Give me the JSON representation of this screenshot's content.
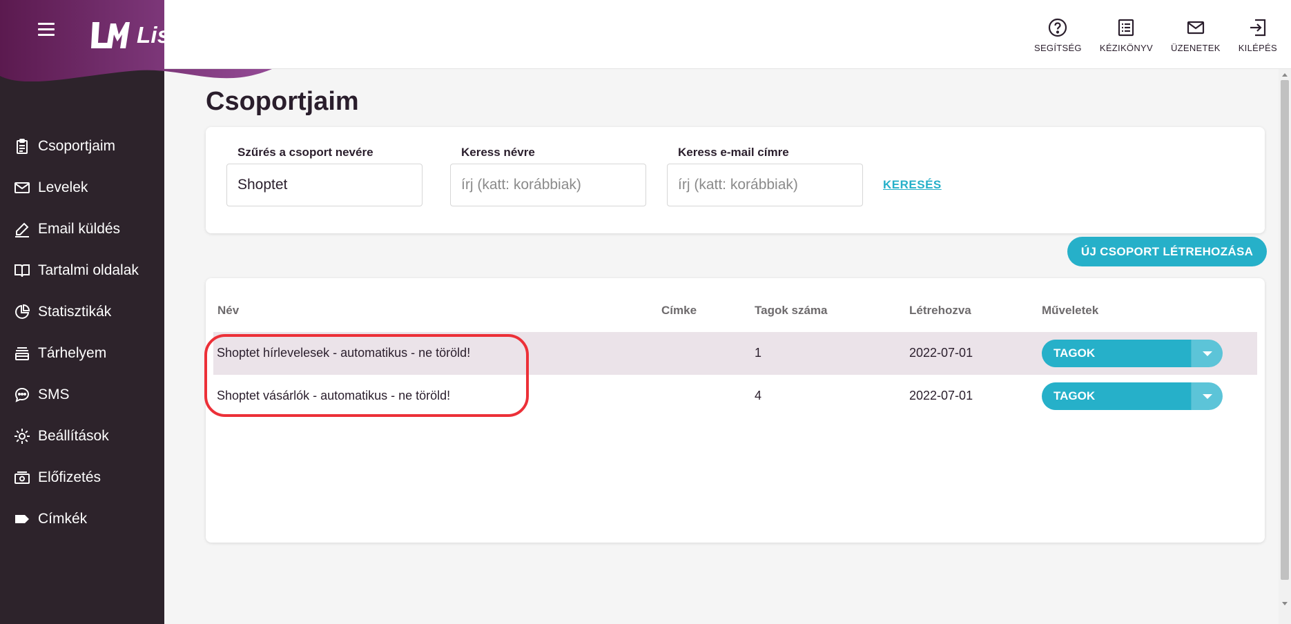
{
  "brand": {
    "name": "ListaMester",
    "gradient_start": "#5b1a4f",
    "gradient_end": "#a257a8"
  },
  "sidebar": {
    "items": [
      {
        "label": "Csoportjaim",
        "icon": "clipboard-icon"
      },
      {
        "label": "Levelek",
        "icon": "envelope-icon"
      },
      {
        "label": "Email küldés",
        "icon": "pencil-icon"
      },
      {
        "label": "Tartalmi oldalak",
        "icon": "book-icon"
      },
      {
        "label": "Statisztikák",
        "icon": "pie-chart-icon"
      },
      {
        "label": "Tárhelyem",
        "icon": "storage-icon"
      },
      {
        "label": "SMS",
        "icon": "chat-icon"
      },
      {
        "label": "Beállítások",
        "icon": "gear-icon"
      },
      {
        "label": "Előfizetés",
        "icon": "money-icon"
      },
      {
        "label": "Címkék",
        "icon": "tag-icon"
      }
    ]
  },
  "header": {
    "actions": [
      {
        "label": "SEGÍTSÉG",
        "icon": "help-icon"
      },
      {
        "label": "KÉZIKÖNYV",
        "icon": "manual-icon"
      },
      {
        "label": "ÜZENETEK",
        "icon": "mail-icon"
      },
      {
        "label": "KILÉPÉS",
        "icon": "logout-icon"
      }
    ]
  },
  "page": {
    "title": "Csoportjaim"
  },
  "filters": {
    "group_label": "Szűrés a csoport nevére",
    "group_value": "Shoptet",
    "name_label": "Keress névre",
    "name_placeholder": "írj (katt: korábbiak)",
    "email_label": "Keress e-mail címre",
    "email_placeholder": "írj (katt: korábbiak)",
    "search_label": "KERESÉS"
  },
  "new_group_button": "ÚJ CSOPORT LÉTREHOZÁSA",
  "table": {
    "columns": [
      "Név",
      "Címke",
      "Tagok száma",
      "Létrehozva",
      "Műveletek"
    ],
    "rows": [
      {
        "name": "Shoptet hírlevelesek - automatikus - ne töröld!",
        "label": "",
        "members": "1",
        "created": "2022-07-01",
        "action": "TAGOK"
      },
      {
        "name": "Shoptet vásárlók - automatikus - ne töröld!",
        "label": "",
        "members": "4",
        "created": "2022-07-01",
        "action": "TAGOK"
      }
    ]
  },
  "colors": {
    "accent": "#26b0c9",
    "sidebar": "#2d232b",
    "highlight": "#ec3038"
  }
}
